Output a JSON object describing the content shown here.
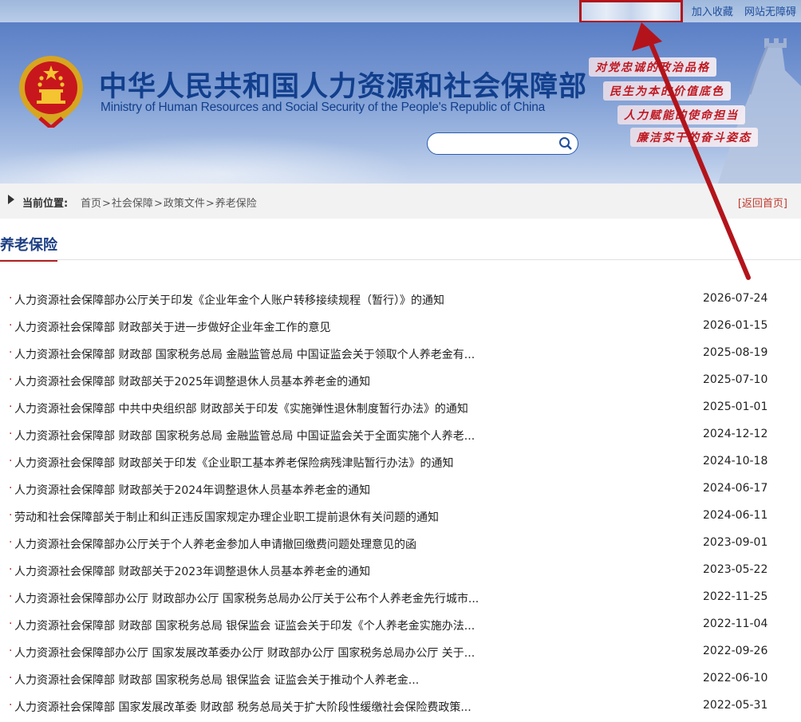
{
  "top_links": {
    "bookmark": "加入收藏",
    "accessibility": "网站无障碍"
  },
  "header": {
    "title": "中华人民共和国人力资源和社会保障部",
    "subtitle": "Ministry of Human Resources and Social Security of the People's Republic of China",
    "slogans": [
      "对党忠诚的政治品格",
      "民生为本的价值底色",
      "人力赋能的使命担当",
      "廉洁实干的奋斗姿态"
    ]
  },
  "search": {
    "placeholder": ""
  },
  "breadcrumb": {
    "label": "当前位置:",
    "items": [
      "首页",
      "社会保障",
      "政策文件",
      "养老保险"
    ],
    "separator": ">",
    "back_home": "[返回首页]"
  },
  "section": {
    "title": "养老保险"
  },
  "articles": [
    {
      "title": "人力资源社会保障部办公厅关于印发《企业年金个人账户转移接续规程（暂行）》的通知",
      "date": "2026-07-24"
    },
    {
      "title": "人力资源社会保障部 财政部关于进一步做好企业年金工作的意见",
      "date": "2026-01-15"
    },
    {
      "title": "人力资源社会保障部 财政部 国家税务总局 金融监管总局 中国证监会关于领取个人养老金有...",
      "date": "2025-08-19"
    },
    {
      "title": "人力资源社会保障部 财政部关于2025年调整退休人员基本养老金的通知",
      "date": "2025-07-10"
    },
    {
      "title": "人力资源社会保障部 中共中央组织部 财政部关于印发《实施弹性退休制度暂行办法》的通知",
      "date": "2025-01-01"
    },
    {
      "title": "人力资源社会保障部 财政部 国家税务总局 金融监管总局 中国证监会关于全面实施个人养老...",
      "date": "2024-12-12"
    },
    {
      "title": "人力资源社会保障部 财政部关于印发《企业职工基本养老保险病残津贴暂行办法》的通知",
      "date": "2024-10-18"
    },
    {
      "title": "人力资源社会保障部 财政部关于2024年调整退休人员基本养老金的通知",
      "date": "2024-06-17"
    },
    {
      "title": "劳动和社会保障部关于制止和纠正违反国家规定办理企业职工提前退休有关问题的通知",
      "date": "2024-06-11"
    },
    {
      "title": "人力资源社会保障部办公厅关于个人养老金参加人申请撤回缴费问题处理意见的函",
      "date": "2023-09-01"
    },
    {
      "title": "人力资源社会保障部 财政部关于2023年调整退休人员基本养老金的通知",
      "date": "2023-05-22"
    },
    {
      "title": "人力资源社会保障部办公厅 财政部办公厅 国家税务总局办公厅关于公布个人养老金先行城市...",
      "date": "2022-11-25"
    },
    {
      "title": "人力资源社会保障部 财政部 国家税务总局 银保监会 证监会关于印发《个人养老金实施办法...",
      "date": "2022-11-04"
    },
    {
      "title": "人力资源社会保障部办公厅 国家发展改革委办公厅 财政部办公厅 国家税务总局办公厅 关于...",
      "date": "2022-09-26"
    },
    {
      "title": "人力资源社会保障部 财政部 国家税务总局 银保监会 证监会关于推动个人养老金...",
      "date": "2022-06-10"
    },
    {
      "title": "人力资源社会保障部 国家发展改革委 财政部 税务总局关于扩大阶段性缓缴社会保险费政策...",
      "date": "2022-05-31"
    }
  ],
  "colors": {
    "brand_blue": "#123f8c",
    "accent_red": "#b22222",
    "annotation_red": "#b3141b"
  },
  "icons": {
    "emblem": "national-emblem-icon",
    "search": "search-icon",
    "crumb": "triangle-right-icon"
  }
}
